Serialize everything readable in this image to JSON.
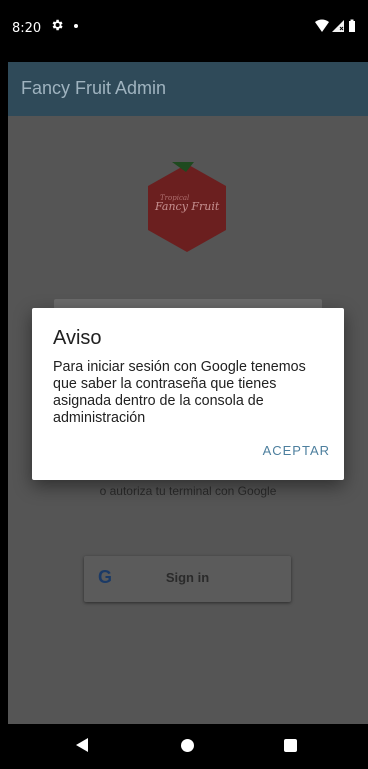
{
  "status_bar": {
    "time": "8:20",
    "icons": [
      "gear-icon",
      "notification-dot-icon",
      "wifi-icon",
      "signal-icon",
      "battery-icon"
    ]
  },
  "app_bar": {
    "title": "Fancy Fruit Admin"
  },
  "logo": {
    "text_small": "Tropical",
    "text_large": "Fancy Fruit",
    "color": "#cc2a2a",
    "leaf_color": "#2e8b2e"
  },
  "login": {
    "hint_text": "o autoriza tu terminal con Google",
    "google_button_label": "Sign in",
    "google_icon": "G"
  },
  "dialog": {
    "title": "Aviso",
    "message": "Para iniciar sesión con Google tenemos que saber la contraseña que tienes asignada dentro de la consola de administración",
    "accept_label": "ACEPTAR"
  },
  "nav_bar": {
    "icons": [
      "back-icon",
      "home-icon",
      "recents-icon"
    ]
  },
  "colors": {
    "app_bar": "#2f4a59",
    "accent": "#4d7f9e",
    "scrim_background": "#555555"
  }
}
